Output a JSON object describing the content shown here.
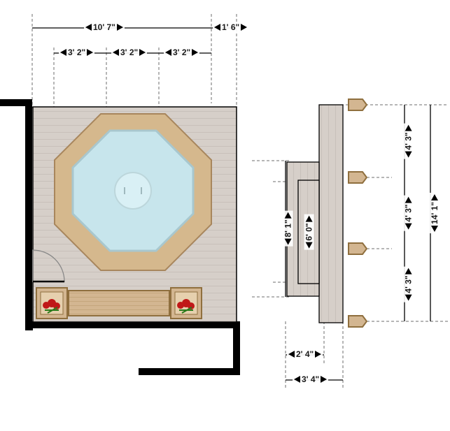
{
  "diagram": {
    "type": "deck-floor-plan",
    "elements": [
      "octagonal-hot-tub",
      "wood-deck",
      "planter-box",
      "bench",
      "walkway",
      "stairs",
      "retaining-wall"
    ]
  },
  "dims": {
    "top_overall": "10' 7\"",
    "top_tub_seg": "3' 2\"",
    "top_gap_right": "1' 6\"",
    "stair_width1": "2' 4\"",
    "stair_width2": "3' 4\"",
    "stair_run1": "6' 0\"",
    "stair_run2": "8' 1\"",
    "rail_seg": "4' 3\"",
    "rail_total": "14' 1\""
  }
}
